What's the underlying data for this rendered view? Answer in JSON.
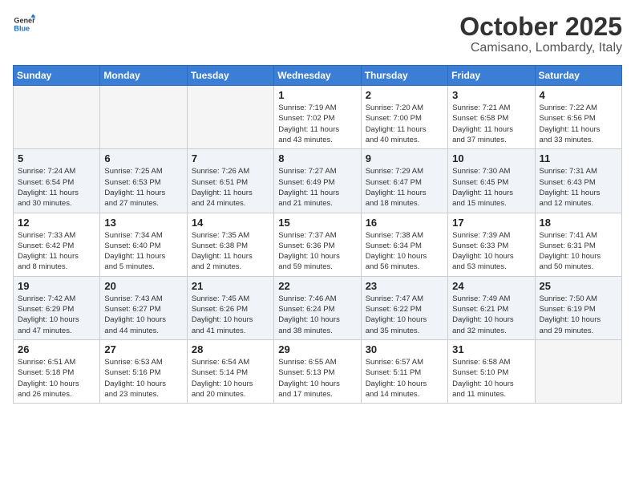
{
  "logo": {
    "general": "General",
    "blue": "Blue"
  },
  "title": {
    "month": "October 2025",
    "location": "Camisano, Lombardy, Italy"
  },
  "days_of_week": [
    "Sunday",
    "Monday",
    "Tuesday",
    "Wednesday",
    "Thursday",
    "Friday",
    "Saturday"
  ],
  "weeks": [
    [
      {
        "day": "",
        "info": ""
      },
      {
        "day": "",
        "info": ""
      },
      {
        "day": "",
        "info": ""
      },
      {
        "day": "1",
        "info": "Sunrise: 7:19 AM\nSunset: 7:02 PM\nDaylight: 11 hours\nand 43 minutes."
      },
      {
        "day": "2",
        "info": "Sunrise: 7:20 AM\nSunset: 7:00 PM\nDaylight: 11 hours\nand 40 minutes."
      },
      {
        "day": "3",
        "info": "Sunrise: 7:21 AM\nSunset: 6:58 PM\nDaylight: 11 hours\nand 37 minutes."
      },
      {
        "day": "4",
        "info": "Sunrise: 7:22 AM\nSunset: 6:56 PM\nDaylight: 11 hours\nand 33 minutes."
      }
    ],
    [
      {
        "day": "5",
        "info": "Sunrise: 7:24 AM\nSunset: 6:54 PM\nDaylight: 11 hours\nand 30 minutes."
      },
      {
        "day": "6",
        "info": "Sunrise: 7:25 AM\nSunset: 6:53 PM\nDaylight: 11 hours\nand 27 minutes."
      },
      {
        "day": "7",
        "info": "Sunrise: 7:26 AM\nSunset: 6:51 PM\nDaylight: 11 hours\nand 24 minutes."
      },
      {
        "day": "8",
        "info": "Sunrise: 7:27 AM\nSunset: 6:49 PM\nDaylight: 11 hours\nand 21 minutes."
      },
      {
        "day": "9",
        "info": "Sunrise: 7:29 AM\nSunset: 6:47 PM\nDaylight: 11 hours\nand 18 minutes."
      },
      {
        "day": "10",
        "info": "Sunrise: 7:30 AM\nSunset: 6:45 PM\nDaylight: 11 hours\nand 15 minutes."
      },
      {
        "day": "11",
        "info": "Sunrise: 7:31 AM\nSunset: 6:43 PM\nDaylight: 11 hours\nand 12 minutes."
      }
    ],
    [
      {
        "day": "12",
        "info": "Sunrise: 7:33 AM\nSunset: 6:42 PM\nDaylight: 11 hours\nand 8 minutes."
      },
      {
        "day": "13",
        "info": "Sunrise: 7:34 AM\nSunset: 6:40 PM\nDaylight: 11 hours\nand 5 minutes."
      },
      {
        "day": "14",
        "info": "Sunrise: 7:35 AM\nSunset: 6:38 PM\nDaylight: 11 hours\nand 2 minutes."
      },
      {
        "day": "15",
        "info": "Sunrise: 7:37 AM\nSunset: 6:36 PM\nDaylight: 10 hours\nand 59 minutes."
      },
      {
        "day": "16",
        "info": "Sunrise: 7:38 AM\nSunset: 6:34 PM\nDaylight: 10 hours\nand 56 minutes."
      },
      {
        "day": "17",
        "info": "Sunrise: 7:39 AM\nSunset: 6:33 PM\nDaylight: 10 hours\nand 53 minutes."
      },
      {
        "day": "18",
        "info": "Sunrise: 7:41 AM\nSunset: 6:31 PM\nDaylight: 10 hours\nand 50 minutes."
      }
    ],
    [
      {
        "day": "19",
        "info": "Sunrise: 7:42 AM\nSunset: 6:29 PM\nDaylight: 10 hours\nand 47 minutes."
      },
      {
        "day": "20",
        "info": "Sunrise: 7:43 AM\nSunset: 6:27 PM\nDaylight: 10 hours\nand 44 minutes."
      },
      {
        "day": "21",
        "info": "Sunrise: 7:45 AM\nSunset: 6:26 PM\nDaylight: 10 hours\nand 41 minutes."
      },
      {
        "day": "22",
        "info": "Sunrise: 7:46 AM\nSunset: 6:24 PM\nDaylight: 10 hours\nand 38 minutes."
      },
      {
        "day": "23",
        "info": "Sunrise: 7:47 AM\nSunset: 6:22 PM\nDaylight: 10 hours\nand 35 minutes."
      },
      {
        "day": "24",
        "info": "Sunrise: 7:49 AM\nSunset: 6:21 PM\nDaylight: 10 hours\nand 32 minutes."
      },
      {
        "day": "25",
        "info": "Sunrise: 7:50 AM\nSunset: 6:19 PM\nDaylight: 10 hours\nand 29 minutes."
      }
    ],
    [
      {
        "day": "26",
        "info": "Sunrise: 6:51 AM\nSunset: 5:18 PM\nDaylight: 10 hours\nand 26 minutes."
      },
      {
        "day": "27",
        "info": "Sunrise: 6:53 AM\nSunset: 5:16 PM\nDaylight: 10 hours\nand 23 minutes."
      },
      {
        "day": "28",
        "info": "Sunrise: 6:54 AM\nSunset: 5:14 PM\nDaylight: 10 hours\nand 20 minutes."
      },
      {
        "day": "29",
        "info": "Sunrise: 6:55 AM\nSunset: 5:13 PM\nDaylight: 10 hours\nand 17 minutes."
      },
      {
        "day": "30",
        "info": "Sunrise: 6:57 AM\nSunset: 5:11 PM\nDaylight: 10 hours\nand 14 minutes."
      },
      {
        "day": "31",
        "info": "Sunrise: 6:58 AM\nSunset: 5:10 PM\nDaylight: 10 hours\nand 11 minutes."
      },
      {
        "day": "",
        "info": ""
      }
    ]
  ]
}
